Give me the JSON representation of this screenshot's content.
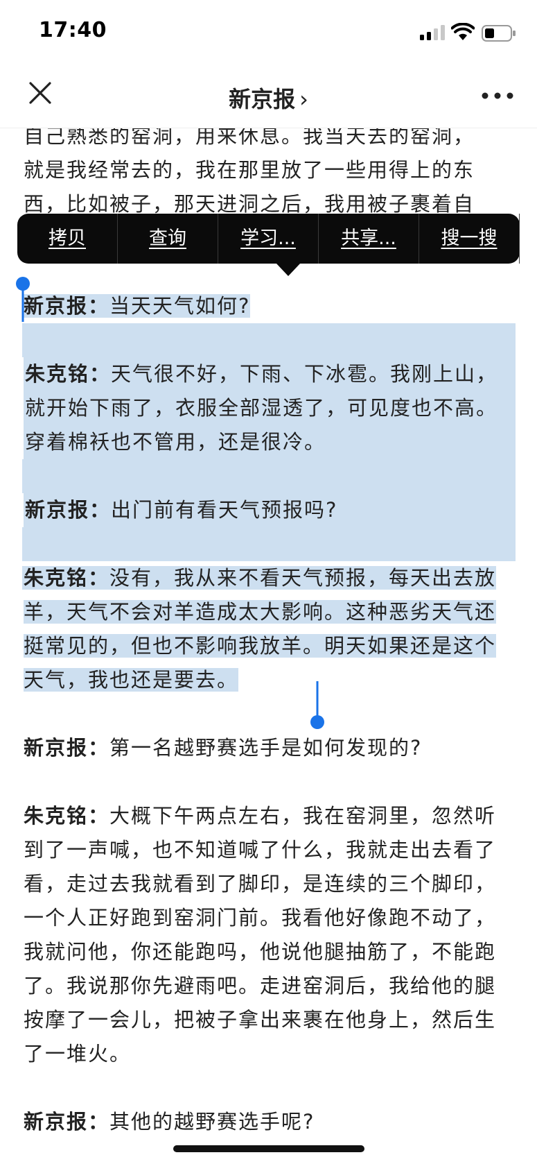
{
  "status_bar": {
    "time": "17:40"
  },
  "nav": {
    "title": "新京报",
    "chevron": "›"
  },
  "context_menu": {
    "items": [
      "拷贝",
      "查询",
      "学习...",
      "共享...",
      "搜一搜"
    ]
  },
  "article": {
    "partial_top": [
      "自己熟悉的窑洞，用来休息。我当天去的窑洞，",
      "就是我经常去的，我在那里放了一些用得上的东",
      "西，比如被子，那天进洞之后，我用被子裹着自"
    ],
    "p1": {
      "speaker": "新京报：",
      "text": "当天天气如何?"
    },
    "p2": {
      "speaker": "朱克铭：",
      "text": "天气很不好，下雨、下冰雹。我刚上山，就开始下雨了，衣服全部湿透了，可见度也不高。穿着棉袄也不管用，还是很冷。"
    },
    "p3": {
      "speaker": "新京报：",
      "text": "出门前有看天气预报吗?"
    },
    "p4": {
      "speaker": "朱克铭：",
      "text": "没有，我从来不看天气预报，每天出去放羊，天气不会对羊造成太大影响。这种恶劣天气还挺常见的，但也不影响我放羊。明天如果还是这个天气，我也还是要去。"
    },
    "p5": {
      "speaker": "新京报：",
      "text": "第一名越野赛选手是如何发现的?"
    },
    "p6": {
      "speaker": "朱克铭：",
      "text": "大概下午两点左右，我在窑洞里，忽然听到了一声喊，也不知道喊了什么，我就走出去看了看，走过去我就看到了脚印，是连续的三个脚印，一个人正好跑到窑洞门前。我看他好像跑不动了，我就问他，你还能跑吗，他说他腿抽筋了，不能跑了。我说那你先避雨吧。走进窑洞后，我给他的腿按摩了一会儿，把被子拿出来裹在他身上，然后生了一堆火。"
    },
    "p7": {
      "speaker": "新京报：",
      "text": "其他的越野赛选手呢?"
    }
  },
  "colors": {
    "selection": "#cddff0",
    "handle": "#1a73e8",
    "menu_bg": "#0b0b0b"
  }
}
